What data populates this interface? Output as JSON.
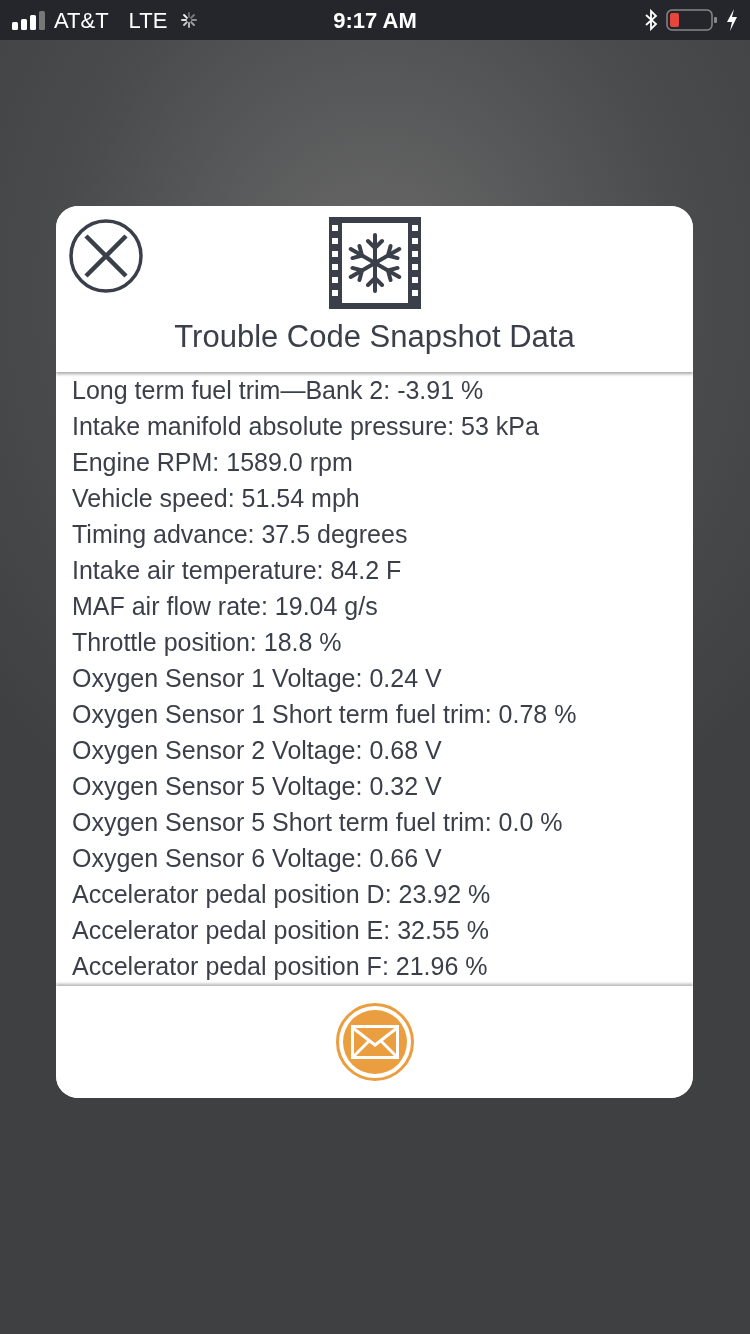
{
  "status_bar": {
    "carrier": "AT&T",
    "network": "LTE",
    "time": "9:17 AM"
  },
  "dialog": {
    "title": "Trouble Code Snapshot Data",
    "rows": [
      "Long term fuel trim—Bank 2: -3.91 %",
      "Intake manifold absolute pressure: 53 kPa",
      "Engine RPM: 1589.0 rpm",
      "Vehicle speed: 51.54 mph",
      "Timing advance: 37.5 degrees",
      "Intake air temperature: 84.2 F",
      "MAF air flow rate: 19.04 g/s",
      "Throttle position: 18.8 %",
      "Oxygen Sensor 1 Voltage: 0.24 V",
      "Oxygen Sensor 1 Short term fuel trim: 0.78 %",
      "Oxygen Sensor 2 Voltage: 0.68 V",
      "Oxygen Sensor 5 Voltage: 0.32 V",
      "Oxygen Sensor 5 Short term fuel trim: 0.0 %",
      "Oxygen Sensor 6 Voltage: 0.66 V",
      "Accelerator pedal position D: 23.92 %",
      "Accelerator pedal position E: 32.55 %",
      "Accelerator pedal position F: 21.96 %"
    ]
  }
}
